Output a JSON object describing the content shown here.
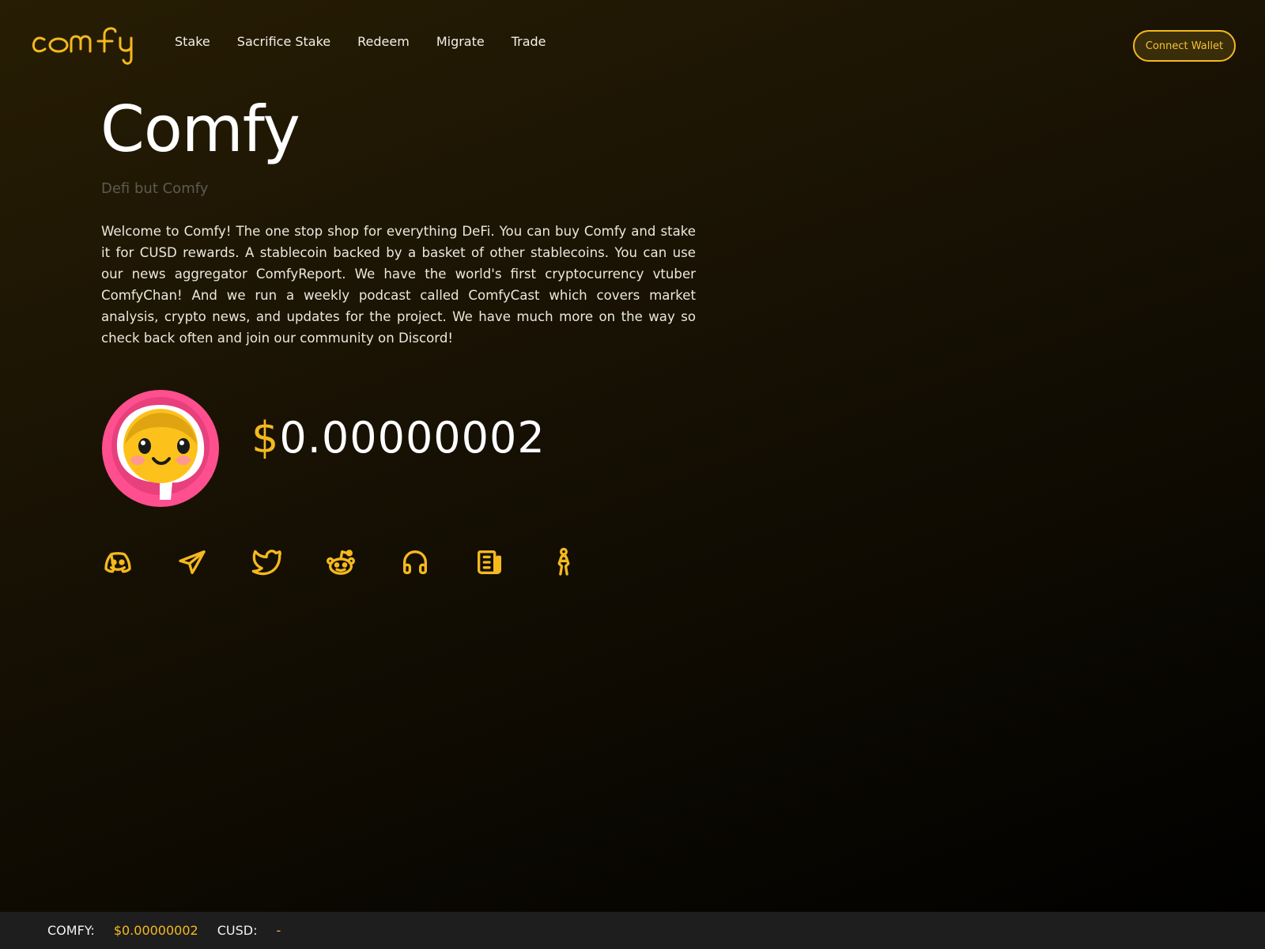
{
  "brand": {
    "logo_text": "comfy",
    "accent_color": "#f5b91e"
  },
  "nav": {
    "links": [
      {
        "label": "Stake"
      },
      {
        "label": "Sacrifice Stake"
      },
      {
        "label": "Redeem"
      },
      {
        "label": "Migrate"
      },
      {
        "label": "Trade"
      }
    ],
    "connect_label": "Connect Wallet"
  },
  "hero": {
    "title": "Comfy",
    "subtitle": "Defi but Comfy",
    "description": "Welcome to Comfy! The one stop shop for everything DeFi. You can buy Comfy and stake it for CUSD rewards. A stablecoin backed by a basket of other stablecoins. You can use our news aggregator ComfyReport. We have the world's first cryptocurrency vtuber ComfyChan! And we run a weekly podcast called ComfyCast which covers market analysis, crypto news, and updates for the project. We have much more on the way so check back often and join our community on Discord!"
  },
  "price": {
    "currency_symbol": "$",
    "value": "0.00000002"
  },
  "socials": [
    {
      "icon": "discord-icon"
    },
    {
      "icon": "telegram-icon"
    },
    {
      "icon": "twitter-icon"
    },
    {
      "icon": "reddit-icon"
    },
    {
      "icon": "headphones-icon"
    },
    {
      "icon": "newspaper-icon"
    },
    {
      "icon": "person-icon"
    }
  ],
  "footer": {
    "comfy_label": "COMFY:",
    "comfy_value": "$0.00000002",
    "cusd_label": "CUSD:",
    "cusd_value": "-"
  }
}
